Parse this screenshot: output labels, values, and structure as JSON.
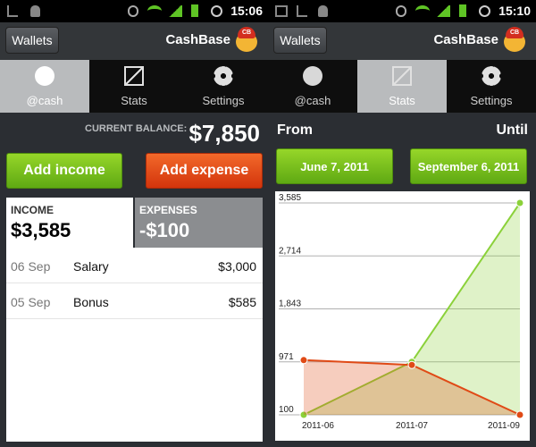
{
  "left": {
    "status": {
      "time": "15:06"
    },
    "header": {
      "wallets_label": "Wallets",
      "app_title": "CashBase",
      "logo_text": "CB"
    },
    "tabs": [
      {
        "label": "@cash",
        "icon": "piggy-bank-icon"
      },
      {
        "label": "Stats",
        "icon": "line-chart-icon"
      },
      {
        "label": "Settings",
        "icon": "gear-icon"
      }
    ],
    "balance": {
      "label": "CURRENT BALANCE:",
      "value": "$7,850"
    },
    "buttons": {
      "add_income": "Add income",
      "add_expense": "Add expense"
    },
    "income": {
      "label": "INCOME",
      "value": "$3,585"
    },
    "expenses": {
      "label": "EXPENSES",
      "value": "-$100"
    },
    "transactions": [
      {
        "date": "06 Sep",
        "name": "Salary",
        "amount": "$3,000"
      },
      {
        "date": "05 Sep",
        "name": "Bonus",
        "amount": "$585"
      }
    ]
  },
  "right": {
    "status": {
      "time": "15:10"
    },
    "header": {
      "wallets_label": "Wallets",
      "app_title": "CashBase",
      "logo_text": "CB"
    },
    "tabs": [
      {
        "label": "@cash",
        "icon": "piggy-bank-icon"
      },
      {
        "label": "Stats",
        "icon": "line-chart-icon"
      },
      {
        "label": "Settings",
        "icon": "gear-icon"
      }
    ],
    "range": {
      "from_label": "From",
      "until_label": "Until",
      "from_date": "June 7, 2011",
      "until_date": "September 6, 2011"
    }
  },
  "colors": {
    "accent_green": "#6dba17",
    "accent_red": "#e04a16",
    "active_tab": "#b9bbbd",
    "income_series": "#8bd13a",
    "expense_series": "#e04a16"
  },
  "chart_data": {
    "type": "area",
    "x": [
      "2011-06",
      "2011-07",
      "2011-09"
    ],
    "y_ticks": [
      "3,585",
      "2,714",
      "1,843",
      "971",
      "100"
    ],
    "ylim": [
      100,
      3585
    ],
    "grid": true,
    "series": [
      {
        "values": [
          100,
          971,
          3585
        ],
        "color": "#8bd13a"
      },
      {
        "values": [
          1000,
          920,
          100
        ],
        "color": "#e04a16"
      }
    ]
  }
}
